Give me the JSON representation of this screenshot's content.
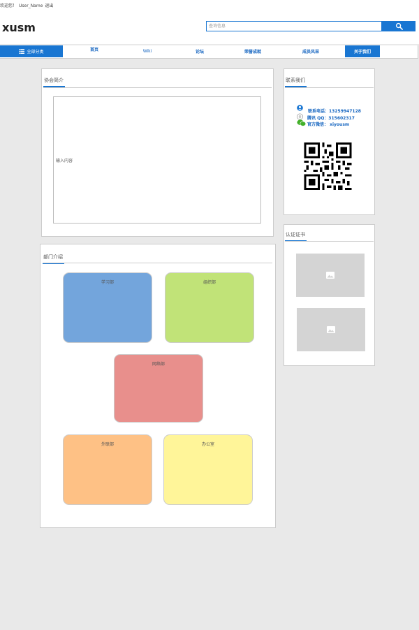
{
  "header": {
    "welcome": "欢迎您！",
    "user": "User_Name",
    "logout": "退出",
    "logo": "xusm",
    "search_placeholder": "查询信息",
    "search_icon": "search-icon"
  },
  "nav": {
    "all_label": "全部分类",
    "items": [
      "首页",
      "Wiki",
      "论坛",
      "荣誉成就",
      "成员风采",
      "关于我们"
    ],
    "active": "关于我们"
  },
  "intro": {
    "title": "协会简介",
    "textarea_value": "输入内容"
  },
  "departments": {
    "title": "部门介绍",
    "items": [
      {
        "label": "学习部",
        "color": "#73a5dc"
      },
      {
        "label": "组织部",
        "color": "#c1e378"
      },
      {
        "label": "网络部",
        "color": "#e88f8c"
      },
      {
        "label": "外联部",
        "color": "#fec185"
      },
      {
        "label": "办公室",
        "color": "#fff599"
      }
    ]
  },
  "contact": {
    "title": "联系我们",
    "phone": "联系电话：13259947128",
    "qq": "腾讯 QQ：315602317",
    "wechat": "官方微信： xiyousm"
  },
  "certificates": {
    "title": "认证证书"
  },
  "colors": {
    "accent": "#1976d2",
    "page_bg": "#e9e9e9"
  }
}
